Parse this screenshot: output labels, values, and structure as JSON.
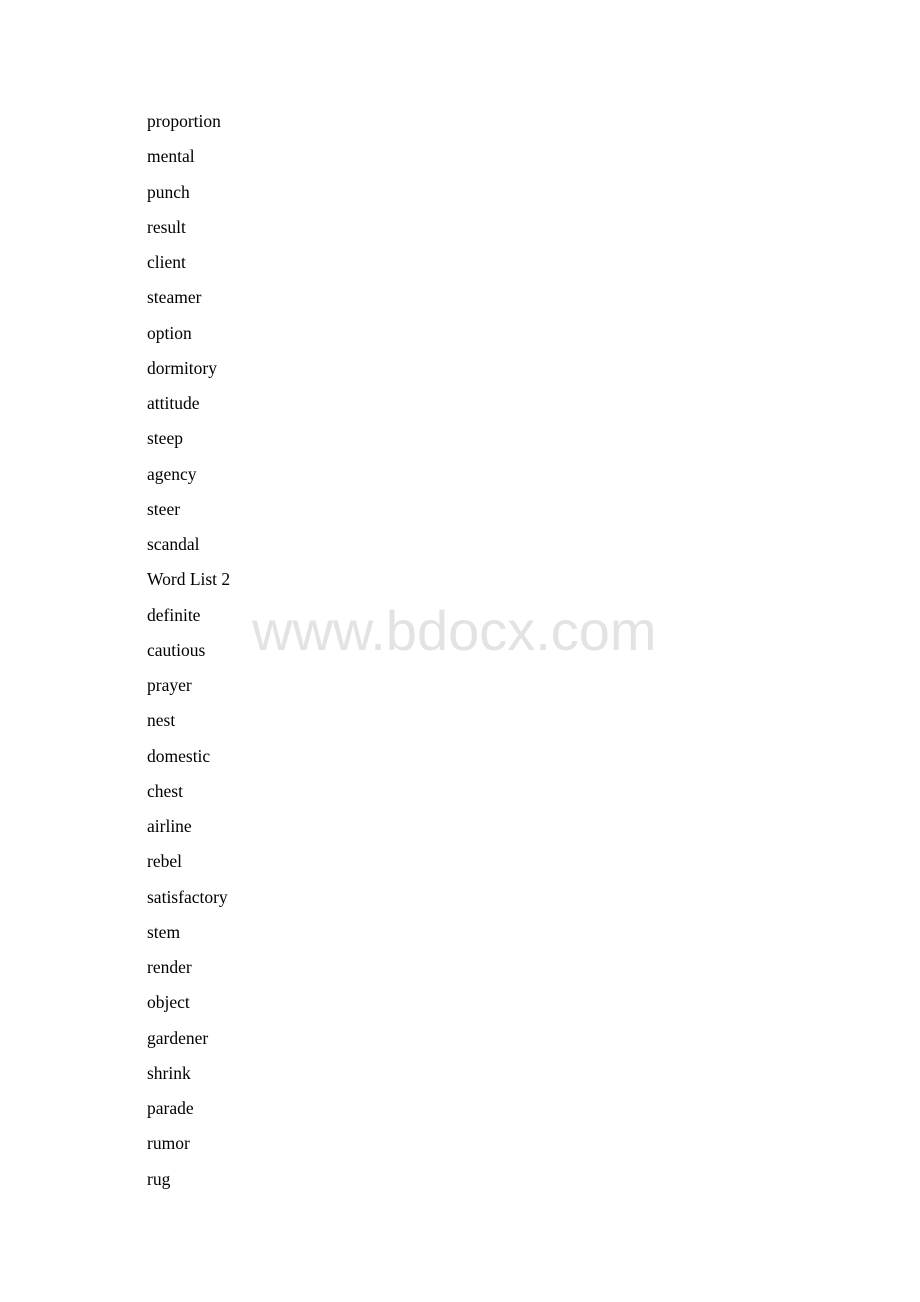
{
  "document": {
    "lines": [
      "proportion",
      "mental",
      "punch",
      "result",
      "client",
      "steamer",
      "option",
      "dormitory",
      "attitude",
      "steep",
      "agency",
      "steer",
      "scandal",
      "Word List 2",
      "definite",
      "cautious",
      "prayer",
      "nest",
      "domestic",
      "chest",
      "airline",
      "rebel",
      "satisfactory",
      "stem",
      "render",
      "object",
      "gardener",
      "shrink",
      "parade",
      "rumor",
      "rug"
    ]
  },
  "watermark": {
    "text": "www.bdocx.com",
    "color": "#e3e3e3"
  }
}
